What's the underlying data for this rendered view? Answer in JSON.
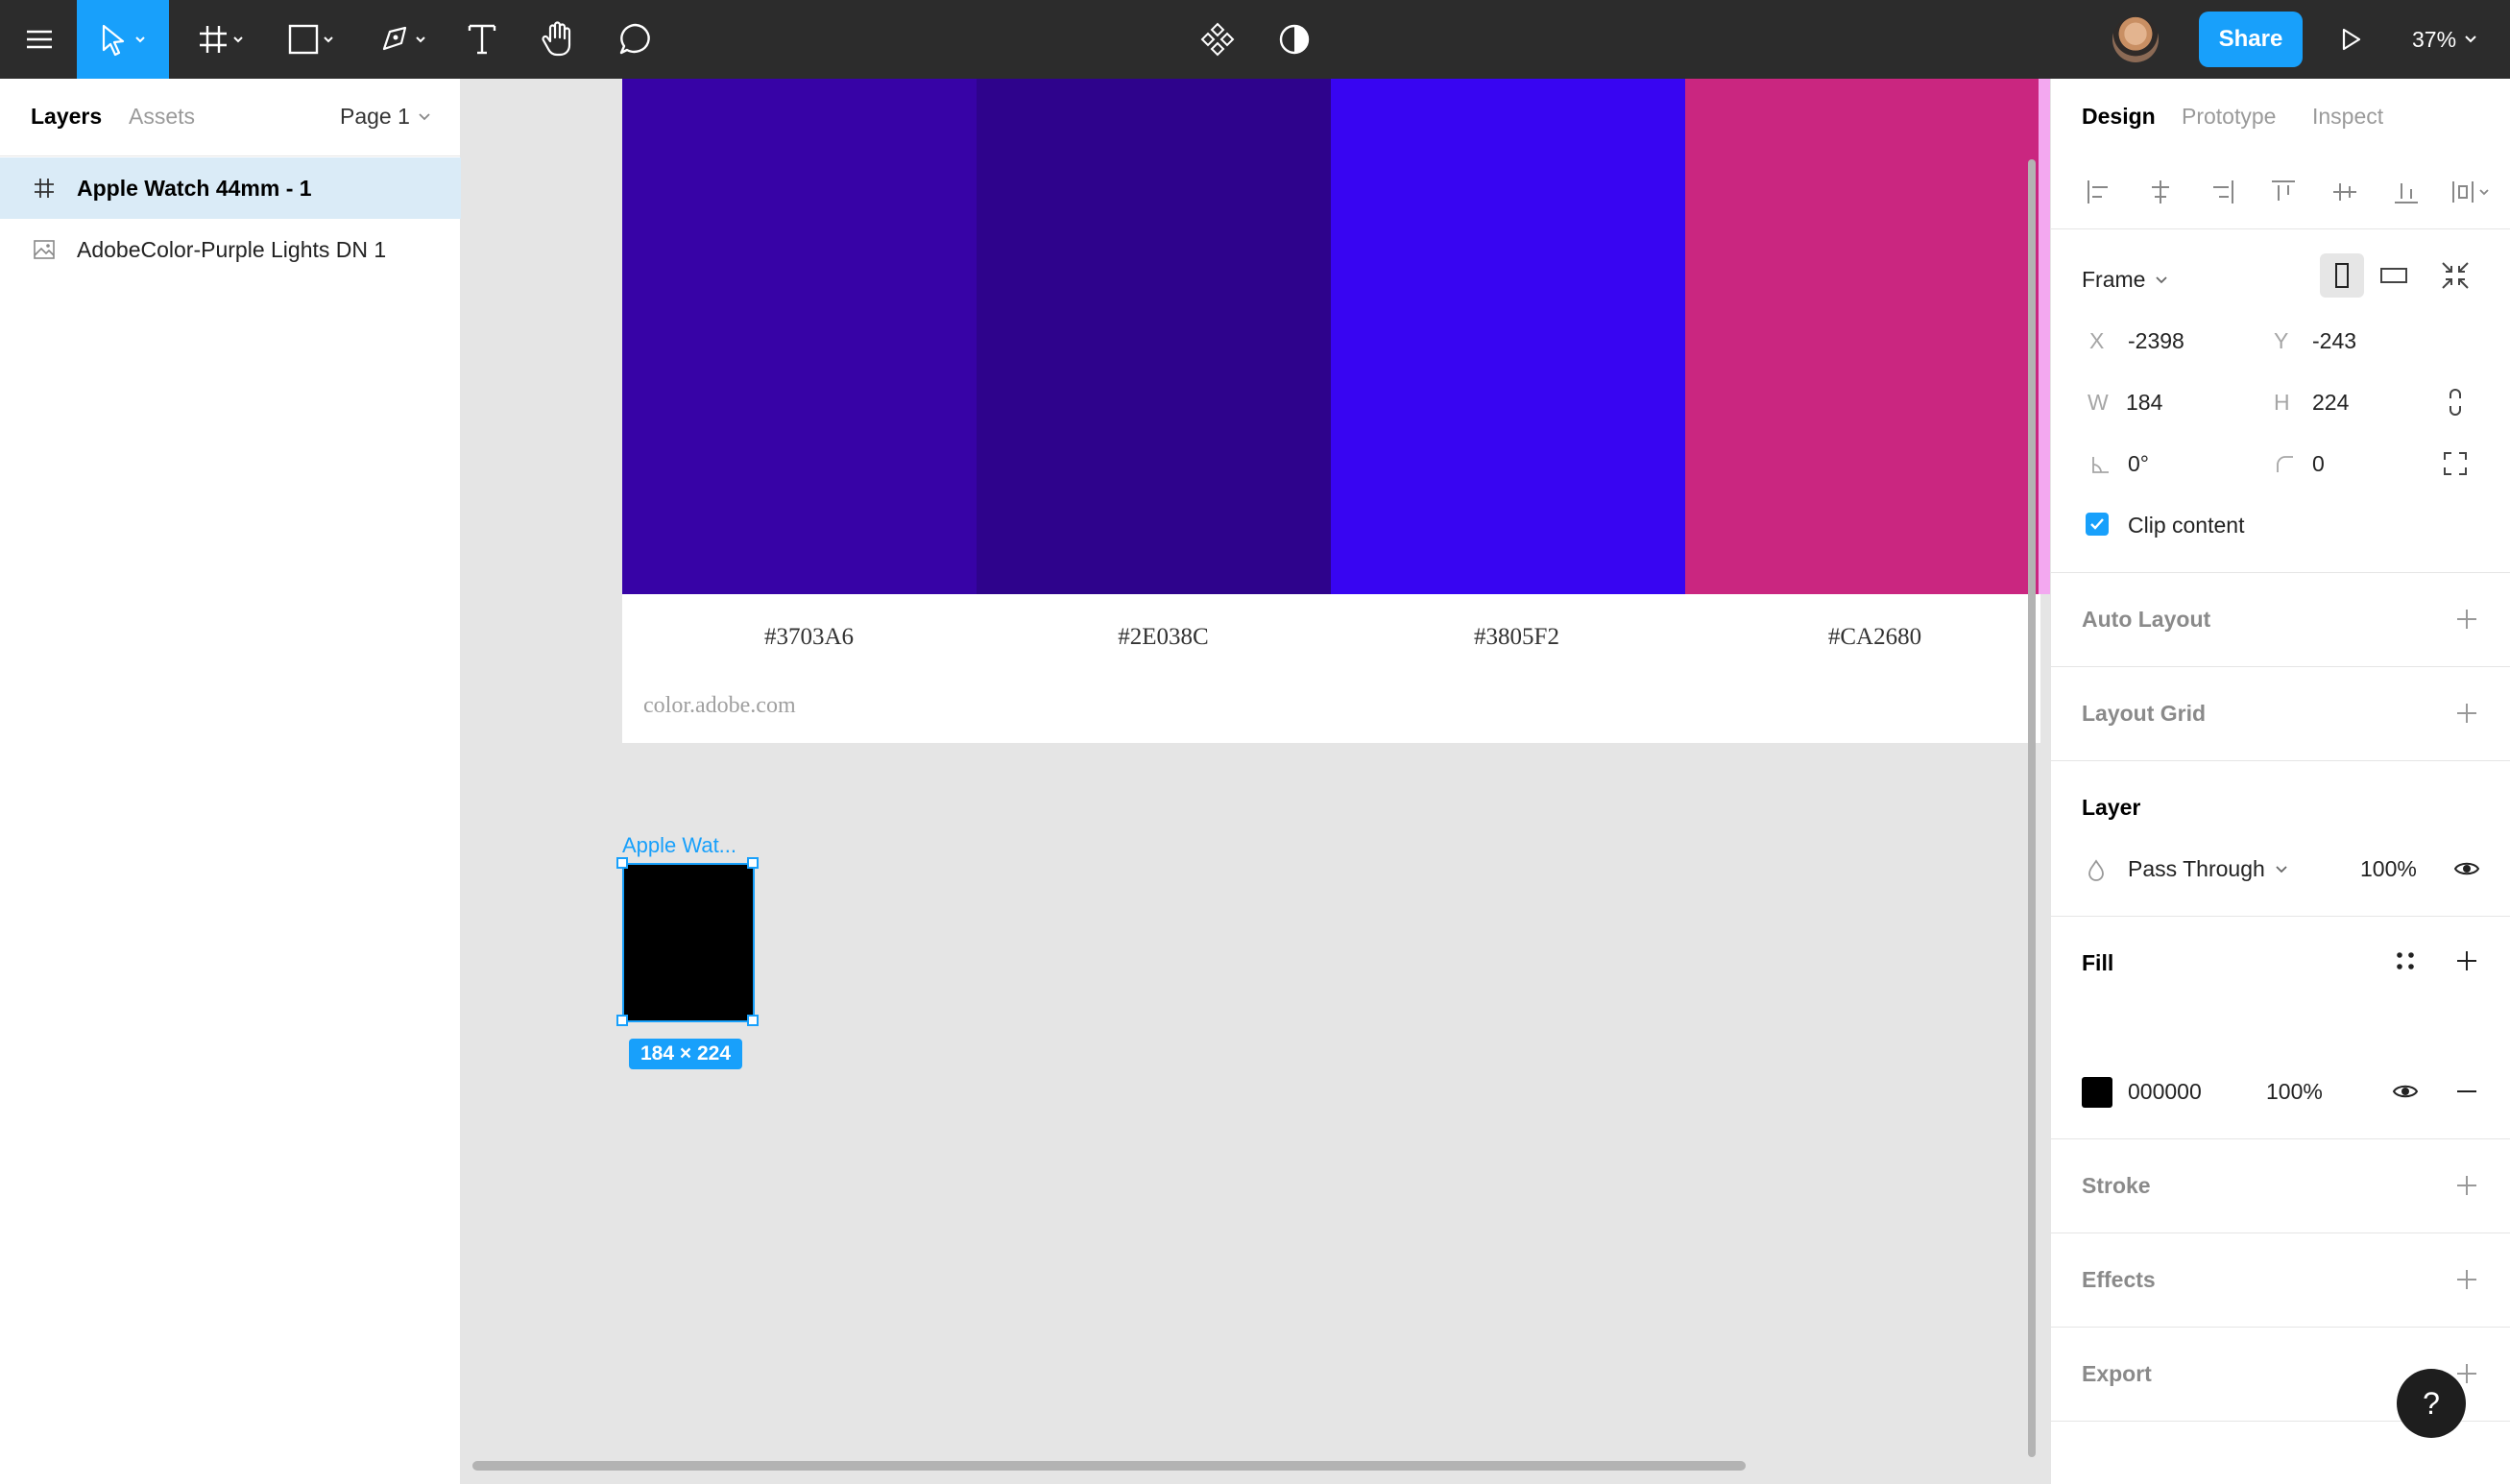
{
  "toolbar": {
    "share_label": "Share",
    "zoom": "37%"
  },
  "left_panel": {
    "tabs": [
      {
        "label": "Layers",
        "active": true
      },
      {
        "label": "Assets",
        "active": false
      }
    ],
    "page_selector": "Page 1",
    "layers": [
      {
        "name": "Apple Watch 44mm - 1",
        "icon": "frame-icon",
        "selected": true
      },
      {
        "name": "AdobeColor-Purple Lights DN 1",
        "icon": "image-icon",
        "selected": false
      }
    ]
  },
  "canvas": {
    "swatches": [
      {
        "color": "#3703A6",
        "label": "#3703A6"
      },
      {
        "color": "#2E038C",
        "label": "#2E038C"
      },
      {
        "color": "#3805F2",
        "label": "#3805F2"
      },
      {
        "color": "#CA2680",
        "label": "#CA2680"
      }
    ],
    "palette_footer": "color.adobe.com",
    "frame_label": "Apple Wat...",
    "frame_size_badge": "184 × 224"
  },
  "right_panel": {
    "tabs": [
      {
        "label": "Design",
        "active": true
      },
      {
        "label": "Prototype",
        "active": false
      },
      {
        "label": "Inspect",
        "active": false
      }
    ],
    "frame_type": "Frame",
    "x_label": "X",
    "x_value": "-2398",
    "y_label": "Y",
    "y_value": "-243",
    "w_label": "W",
    "w_value": "184",
    "h_label": "H",
    "h_value": "224",
    "rotation": "0°",
    "corner_radius": "0",
    "clip_content_label": "Clip content",
    "clip_content_checked": true,
    "auto_layout": "Auto Layout",
    "layout_grid": "Layout Grid",
    "layer_title": "Layer",
    "blend_mode": "Pass Through",
    "layer_opacity": "100%",
    "fill_title": "Fill",
    "fill_hex": "000000",
    "fill_opacity": "100%",
    "stroke_title": "Stroke",
    "effects_title": "Effects",
    "export_title": "Export",
    "help_label": "?"
  },
  "colors": {
    "accent": "#18a0fb",
    "toolbar_bg": "#2c2c2c",
    "canvas_bg": "#e5e5e5"
  }
}
